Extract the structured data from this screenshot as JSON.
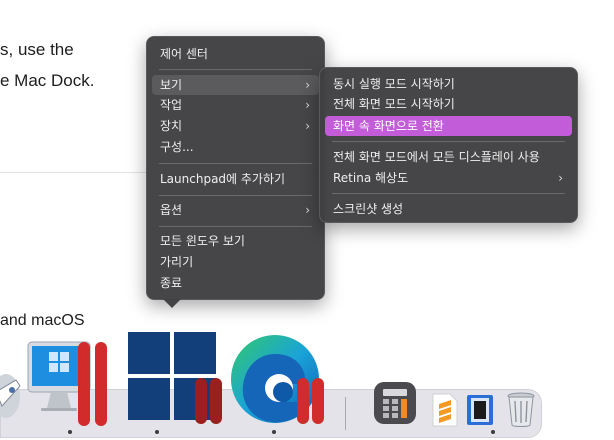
{
  "background": {
    "line1": "s, use the",
    "line2": "e Mac Dock.",
    "line3": "and macOS"
  },
  "menu_main": {
    "items": [
      {
        "label": "제어 센터"
      },
      {
        "label": "보기",
        "arrow": "›"
      },
      {
        "label": "작업",
        "arrow": "›"
      },
      {
        "label": "장치",
        "arrow": "›"
      },
      {
        "label": "구성..."
      },
      {
        "label": "Launchpad에 추가하기"
      },
      {
        "label": "옵션",
        "arrow": "›"
      },
      {
        "label": "모든 윈도우 보기"
      },
      {
        "label": "가리기"
      },
      {
        "label": "종료"
      }
    ]
  },
  "menu_sub": {
    "items": [
      {
        "label": "동시 실행 모드 시작하기"
      },
      {
        "label": "전체 화면 모드 시작하기"
      },
      {
        "label": "화면 속 화면으로 전환"
      },
      {
        "label": "전체 화면 모드에서 모든 디스플레이 사용"
      },
      {
        "label": "Retina 해상도",
        "arrow": "›"
      },
      {
        "label": "스크린샷 생성"
      }
    ]
  },
  "colors": {
    "menu_bg": "#404042",
    "highlight": "#c35cd8",
    "parallels_red": "#d12b2b"
  },
  "dock": {
    "icons": [
      "launchpad-rocket-icon",
      "windows-vm-imac-icon",
      "windows-11-vm-icon",
      "edge-vm-icon",
      "calculator-icon",
      "sublime-text-icon",
      "preview-icon",
      "trash-icon"
    ]
  }
}
